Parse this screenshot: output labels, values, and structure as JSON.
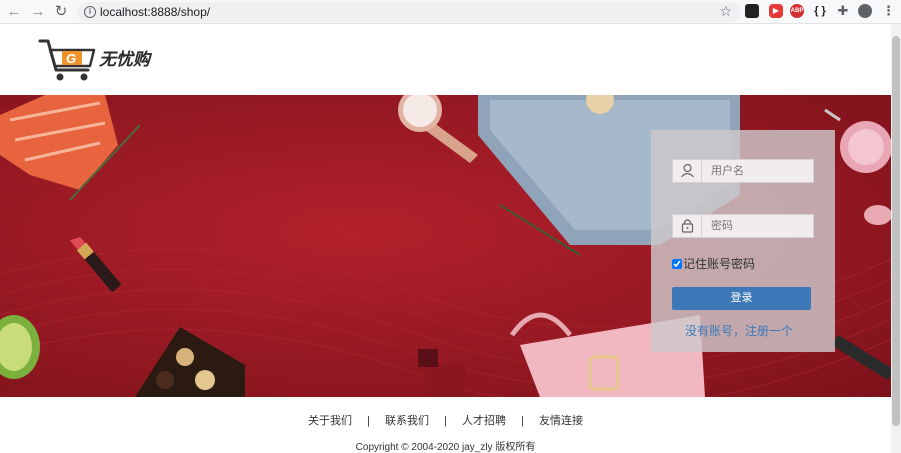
{
  "browser": {
    "url": "localhost:8888/shop/",
    "back_icon": "arrow-left-icon",
    "forward_icon": "arrow-right-icon",
    "reload_icon": "reload-icon",
    "extensions": [
      {
        "name": "ext-1-icon",
        "label": "",
        "color": "#222222"
      },
      {
        "name": "youtube-icon",
        "label": "",
        "color": "#e53935"
      },
      {
        "name": "abp-icon",
        "label": "ABP",
        "color": "#d32f2f"
      },
      {
        "name": "braces-icon",
        "label": "{ }",
        "color": "#202124"
      },
      {
        "name": "puzzle-icon",
        "label": "",
        "color": "#5f6368"
      },
      {
        "name": "profile-icon",
        "label": "",
        "color": "#5f6368"
      }
    ]
  },
  "header": {
    "logo_text": "无忧购",
    "logo_letter": "G"
  },
  "login": {
    "username_placeholder": "用户名",
    "password_placeholder": "密码",
    "remember_label": "记住账号密码",
    "remember_checked": true,
    "submit_label": "登录",
    "register_link": "没有账号，注册一个"
  },
  "footer": {
    "links": [
      "关于我们",
      "联系我们",
      "人才招聘",
      "友情连接"
    ],
    "separator": "|",
    "copyright": "Copyright © 2004-2020 jay_zly 版权所有"
  },
  "colors": {
    "banner": "#9a1a24",
    "button": "#3d79b8",
    "logo_orange": "#f0922b"
  }
}
